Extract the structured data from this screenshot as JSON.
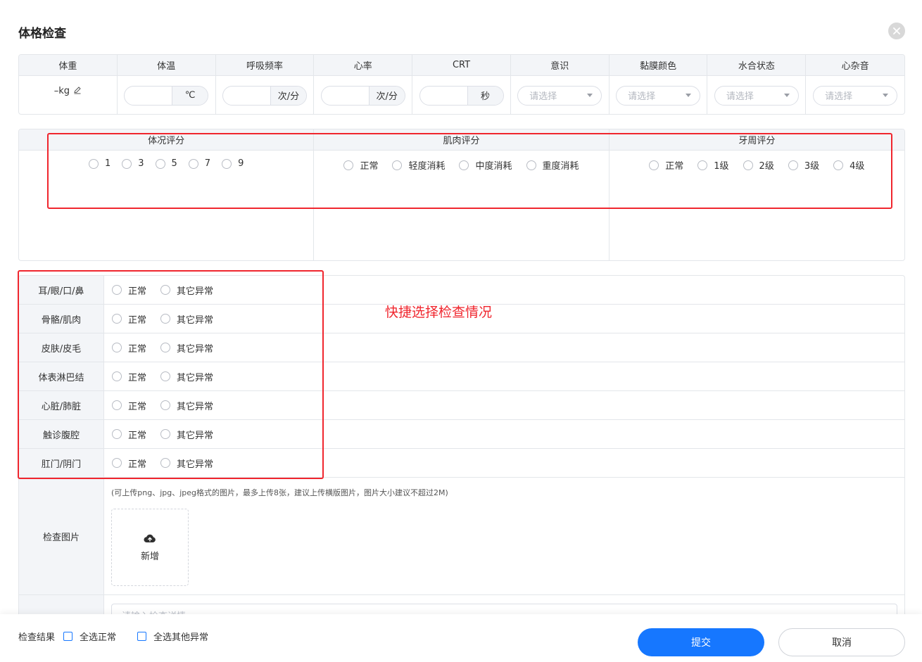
{
  "dialog": {
    "title": "体格检查"
  },
  "vitals": {
    "headers": [
      "体重",
      "体温",
      "呼吸频率",
      "心率",
      "CRT",
      "意识",
      "黏膜颜色",
      "水合状态",
      "心杂音"
    ],
    "weight_value": "–kg",
    "temperature_unit": "℃",
    "respiration_unit": "次/分",
    "heart_rate_unit": "次/分",
    "crt_unit": "秒",
    "select_placeholder": "请选择"
  },
  "scores": [
    {
      "title": "体况评分",
      "options": [
        "1",
        "3",
        "5",
        "7",
        "9"
      ]
    },
    {
      "title": "肌肉评分",
      "options": [
        "正常",
        "轻度消耗",
        "中度消耗",
        "重度消耗"
      ]
    },
    {
      "title": "牙周评分",
      "options": [
        "正常",
        "1级",
        "2级",
        "3级",
        "4级"
      ]
    }
  ],
  "checks": {
    "rows": [
      {
        "label": "耳/眼/口/鼻"
      },
      {
        "label": "骨骼/肌肉"
      },
      {
        "label": "皮肤/皮毛"
      },
      {
        "label": "体表淋巴结"
      },
      {
        "label": "心脏/肺脏"
      },
      {
        "label": "触诊腹腔"
      },
      {
        "label": "肛门/阴门"
      }
    ],
    "option_normal": "正常",
    "option_abnormal": "其它异常"
  },
  "photos": {
    "label": "检查图片",
    "hint": "(可上传png、jpg、jpeg格式的图片，最多上传8张，建议上传横版图片，图片大小建议不超过2M)",
    "upload_label": "新增"
  },
  "details": {
    "placeholder": "请输入检查详情"
  },
  "annotation": {
    "text": "快捷选择检查情况",
    "color": "#f0262e"
  },
  "footer": {
    "result_label": "检查结果",
    "select_all_normal": "全选正常",
    "select_all_abnormal": "全选其他异常",
    "submit": "提交",
    "cancel": "取消"
  },
  "colors": {
    "primary": "#1677ff",
    "border": "#e3e6ea",
    "header_bg": "#f3f5f8",
    "annotation": "#f0262e"
  }
}
